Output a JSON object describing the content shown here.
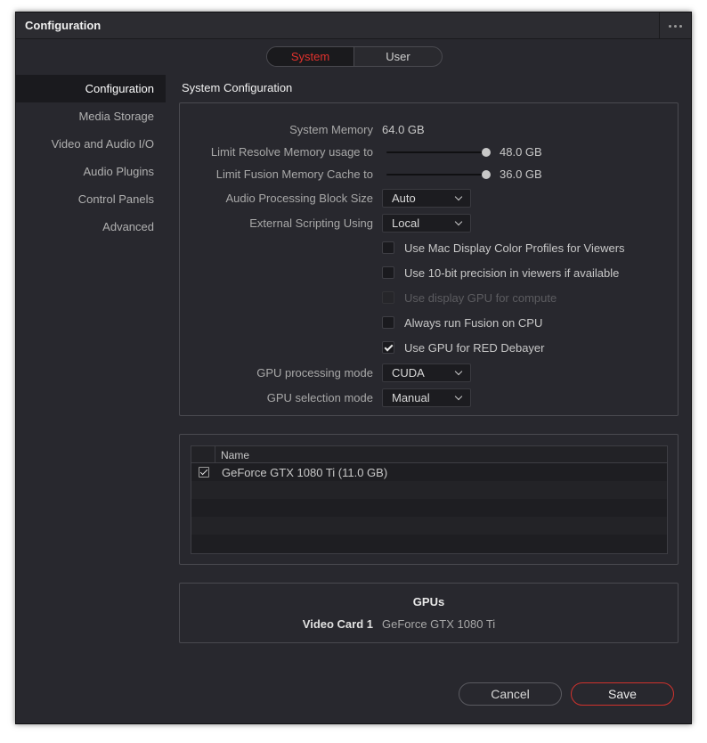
{
  "window": {
    "title": "Configuration"
  },
  "tabs": [
    {
      "label": "System",
      "active": true
    },
    {
      "label": "User",
      "active": false
    }
  ],
  "sidebar": {
    "items": [
      {
        "label": "Configuration",
        "active": true
      },
      {
        "label": "Media Storage"
      },
      {
        "label": "Video and Audio I/O"
      },
      {
        "label": "Audio Plugins"
      },
      {
        "label": "Control Panels"
      },
      {
        "label": "Advanced"
      }
    ]
  },
  "main": {
    "section_title": "System Configuration",
    "system_memory": {
      "label": "System Memory",
      "value": "64.0 GB"
    },
    "resolve_memory": {
      "label": "Limit Resolve Memory usage to",
      "value": "48.0 GB",
      "fraction": 1.0
    },
    "fusion_memory": {
      "label": "Limit Fusion Memory Cache to",
      "value": "36.0 GB",
      "fraction": 1.0
    },
    "audio_block": {
      "label": "Audio Processing Block Size",
      "value": "Auto"
    },
    "scripting": {
      "label": "External Scripting Using",
      "value": "Local"
    },
    "checkboxes": [
      {
        "label": "Use Mac Display Color Profiles for Viewers",
        "checked": false,
        "disabled": false
      },
      {
        "label": "Use 10-bit precision in viewers if available",
        "checked": false,
        "disabled": false
      },
      {
        "label": "Use display GPU for compute",
        "checked": false,
        "disabled": true
      },
      {
        "label": "Always run Fusion on CPU",
        "checked": false,
        "disabled": false
      },
      {
        "label": "Use GPU for RED Debayer",
        "checked": true,
        "disabled": false
      }
    ],
    "gpu_processing": {
      "label": "GPU processing mode",
      "value": "CUDA"
    },
    "gpu_selection": {
      "label": "GPU selection mode",
      "value": "Manual"
    }
  },
  "gpu_table": {
    "header": "Name",
    "rows": [
      {
        "name": "GeForce GTX 1080 Ti (11.0 GB)",
        "checked": true
      }
    ]
  },
  "gpus": {
    "title": "GPUs",
    "card_label": "Video Card 1",
    "card_value": "GeForce GTX 1080 Ti"
  },
  "footer": {
    "cancel_label": "Cancel",
    "save_label": "Save"
  },
  "colors": {
    "accent": "#e0322d",
    "background": "#28282e"
  }
}
